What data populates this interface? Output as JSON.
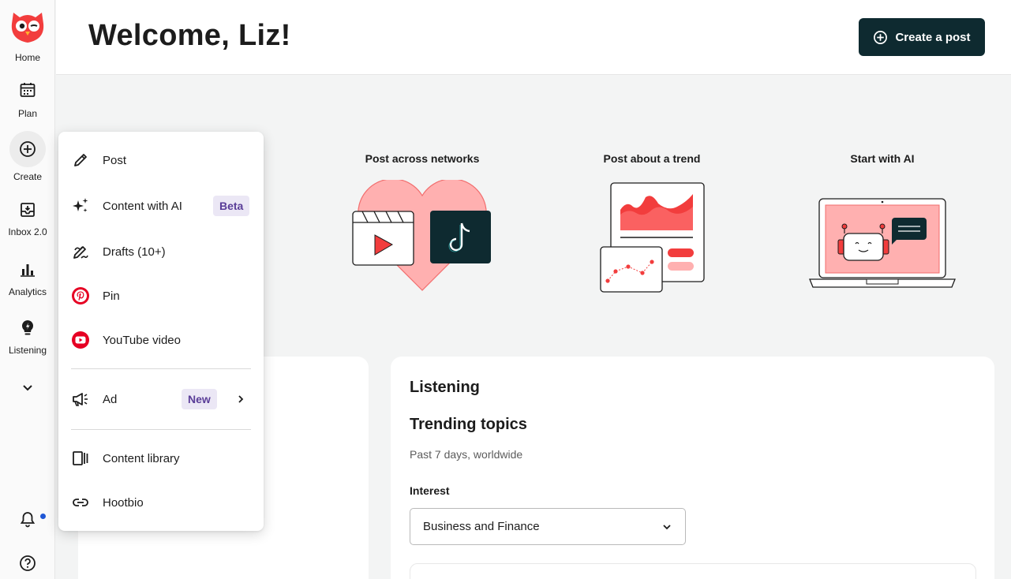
{
  "sidebar": {
    "items": [
      {
        "label": "Home",
        "icon": "owl-logo-icon"
      },
      {
        "label": "Plan",
        "icon": "calendar-icon"
      },
      {
        "label": "Create",
        "icon": "plus-circle-icon"
      },
      {
        "label": "Inbox 2.0",
        "icon": "inbox-icon"
      },
      {
        "label": "Analytics",
        "icon": "bar-chart-icon"
      },
      {
        "label": "Listening",
        "icon": "lightbulb-icon"
      }
    ],
    "more_icon": "chevron-down-icon",
    "bottom": [
      "bell-icon",
      "help-icon"
    ]
  },
  "header": {
    "title": "Welcome, Liz!",
    "create_button": "Create a post"
  },
  "quick_actions": [
    {
      "title": "Post across networks"
    },
    {
      "title": "Post about a trend"
    },
    {
      "title": "Start with AI"
    }
  ],
  "listening": {
    "title": "Listening",
    "section_title": "Trending topics",
    "subtitle": "Past 7 days, worldwide",
    "interest_label": "Interest",
    "interest_value": "Business and Finance"
  },
  "create_menu": {
    "items": [
      {
        "label": "Post",
        "icon": "pencil-icon"
      },
      {
        "label": "Content with AI",
        "icon": "sparkles-icon",
        "badge": "Beta"
      },
      {
        "label": "Drafts (10+)",
        "icon": "draft-pencil-icon"
      },
      {
        "label": "Pin",
        "icon": "pinterest-icon"
      },
      {
        "label": "YouTube video",
        "icon": "youtube-icon"
      },
      {
        "label": "Ad",
        "icon": "megaphone-icon",
        "badge": "New"
      },
      {
        "label": "Content library",
        "icon": "library-icon"
      },
      {
        "label": "Hootbio",
        "icon": "link-icon"
      }
    ]
  },
  "colors": {
    "primary_dark": "#0e2a30",
    "brand_red": "#f23d3d",
    "badge_bg": "#ebe7f5",
    "badge_text": "#5a3d98",
    "notification_dot": "#1f57d6"
  }
}
